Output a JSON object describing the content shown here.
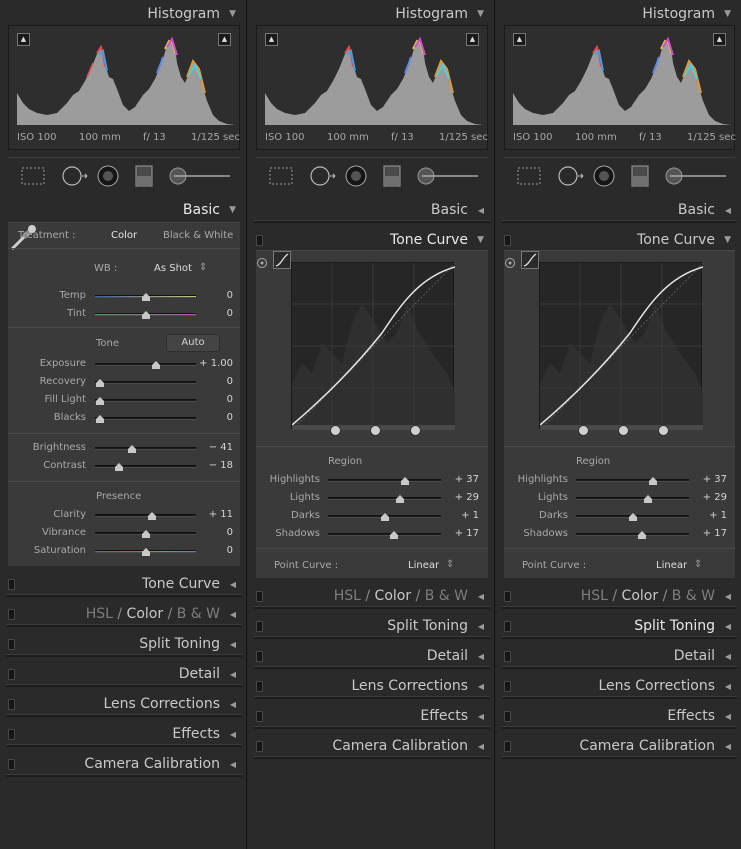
{
  "histogram": {
    "title": "Histogram",
    "iso": "ISO 100",
    "focal": "100 mm",
    "aperture": "f/ 13",
    "shutter": "1/125 sec"
  },
  "sections": {
    "basic": "Basic",
    "tone_curve": "Tone Curve",
    "hsl": "HSL",
    "color": "Color",
    "bw": "B & W",
    "slash": "/",
    "split_toning": "Split Toning",
    "detail": "Detail",
    "lens_corrections": "Lens Corrections",
    "effects": "Effects",
    "camera_calibration": "Camera Calibration"
  },
  "basic": {
    "treatment_label": "Treatment :",
    "treatment_color": "Color",
    "treatment_bw": "Black & White",
    "wb_label": "WB :",
    "wb_value": "As Shot",
    "temp": {
      "label": "Temp",
      "value": "0",
      "pos": 0.5
    },
    "tint": {
      "label": "Tint",
      "value": "0",
      "pos": 0.5
    },
    "tone_heading": "Tone",
    "auto_label": "Auto",
    "exposure": {
      "label": "Exposure",
      "value": "+ 1.00",
      "pos": 0.6
    },
    "recovery": {
      "label": "Recovery",
      "value": "0",
      "pos": 0.05
    },
    "fill_light": {
      "label": "Fill Light",
      "value": "0",
      "pos": 0.05
    },
    "blacks": {
      "label": "Blacks",
      "value": "0",
      "pos": 0.05
    },
    "brightness": {
      "label": "Brightness",
      "value": "− 41",
      "pos": 0.37
    },
    "contrast": {
      "label": "Contrast",
      "value": "− 18",
      "pos": 0.24
    },
    "presence_heading": "Presence",
    "clarity": {
      "label": "Clarity",
      "value": "+ 11",
      "pos": 0.56
    },
    "vibrance": {
      "label": "Vibrance",
      "value": "0",
      "pos": 0.5
    },
    "saturation": {
      "label": "Saturation",
      "value": "0",
      "pos": 0.5
    }
  },
  "tone_curve": {
    "region_heading": "Region",
    "highlights": {
      "label": "Highlights",
      "value": "+ 37",
      "pos": 0.68
    },
    "lights": {
      "label": "Lights",
      "value": "+ 29",
      "pos": 0.64
    },
    "darks": {
      "label": "Darks",
      "value": "+ 1",
      "pos": 0.5
    },
    "shadows": {
      "label": "Shadows",
      "value": "+ 17",
      "pos": 0.58
    },
    "point_curve_label": "Point Curve :",
    "point_curve_value": "Linear"
  },
  "colors": {
    "panel": "#3a3a3a",
    "background": "#2a2a2a",
    "text": "#b5b5b5",
    "highlight_text": "#e9e9e9"
  }
}
